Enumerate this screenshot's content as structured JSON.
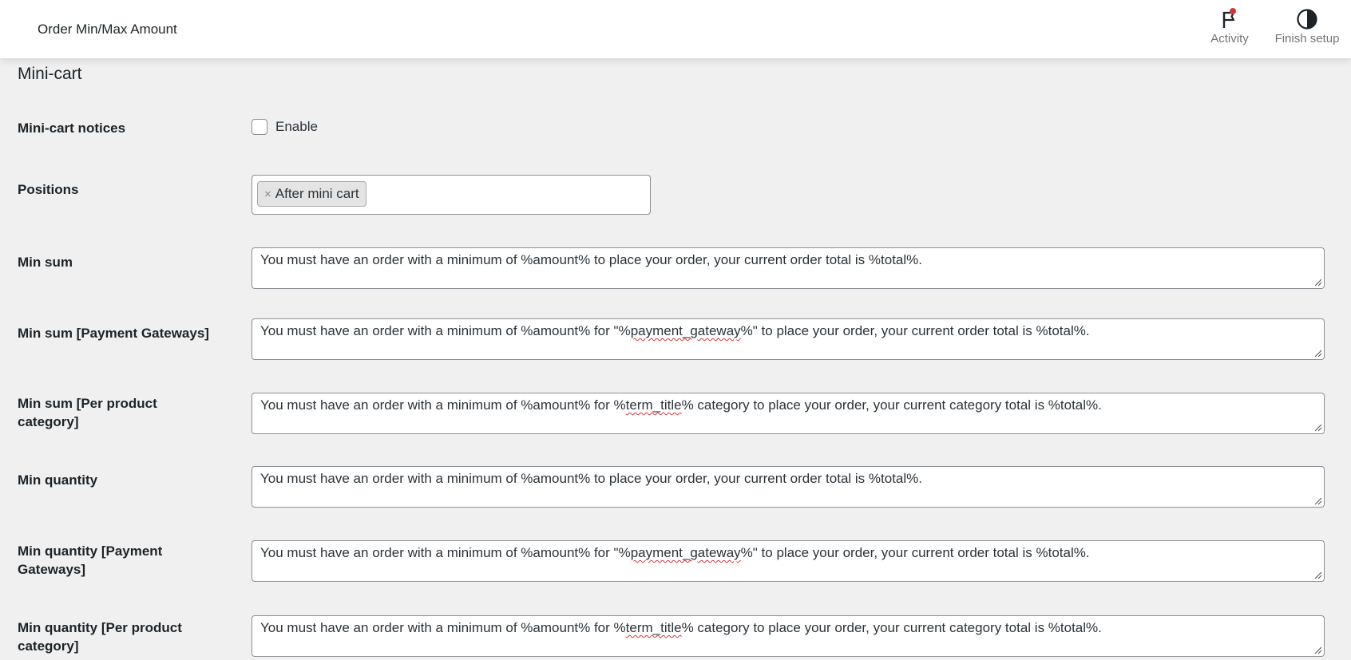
{
  "header": {
    "title": "Order Min/Max Amount",
    "activity_label": "Activity",
    "finish_setup_label": "Finish setup",
    "activity_icon": "flag-icon",
    "finish_icon": "half-circle-icon",
    "notification_color": "#d63638"
  },
  "section": {
    "title": "Mini-cart"
  },
  "fields": {
    "notices": {
      "label": "Mini-cart notices",
      "checkbox_label": "Enable",
      "checked": false
    },
    "positions": {
      "label": "Positions",
      "selected": "After mini cart",
      "remove_glyph": "×"
    },
    "min_sum": {
      "label": "Min sum",
      "value": "You must have an order with a minimum of %amount% to place your order, your current order total is %total%."
    },
    "min_sum_pg": {
      "label": "Min sum [Payment Gateways]",
      "pre": "You must have an order with a minimum of %amount% for \"%",
      "mark": "payment_gateway",
      "post": "%\" to place your order, your current order total is %total%."
    },
    "min_sum_cat": {
      "label": "Min sum [Per product category]",
      "pre": "You must have an order with a minimum of %amount% for %",
      "mark": "term_title",
      "post": "% category to place your order, your current category total is %total%."
    },
    "min_qty": {
      "label": "Min quantity",
      "value": "You must have an order with a minimum of %amount% to place your order, your current order total is %total%."
    },
    "min_qty_pg": {
      "label": "Min quantity [Payment Gateways]",
      "pre": "You must have an order with a minimum of %amount% for \"%",
      "mark": "payment_gateway",
      "post": "%\" to place your order, your current order total is %total%."
    },
    "min_qty_cat": {
      "label": "Min quantity [Per product category]",
      "pre": "You must have an order with a minimum of %amount% for %",
      "mark": "term_title",
      "post": "% category to place your order, your current category total is %total%."
    }
  }
}
